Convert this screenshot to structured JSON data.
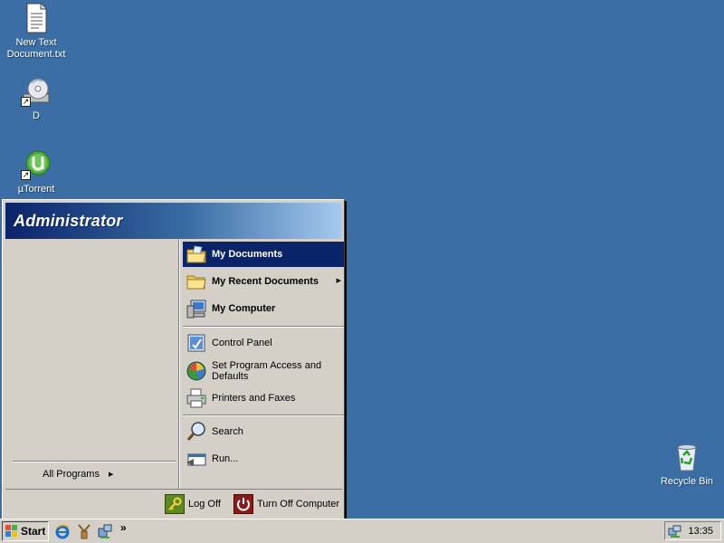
{
  "desktop": {
    "icons": [
      {
        "label": "New Text Document.txt"
      },
      {
        "label": "D"
      },
      {
        "label": "µTorrent"
      },
      {
        "label": "Recycle Bin"
      }
    ]
  },
  "start_menu": {
    "user": "Administrator",
    "all_programs": "All Programs",
    "items": [
      {
        "label": "My Documents"
      },
      {
        "label": "My Recent Documents"
      },
      {
        "label": "My Computer"
      },
      {
        "label": "Control Panel"
      },
      {
        "label": "Set Program Access and Defaults"
      },
      {
        "label": "Printers and Faxes"
      },
      {
        "label": "Search"
      },
      {
        "label": "Run..."
      }
    ],
    "log_off": "Log Off",
    "turn_off": "Turn Off Computer"
  },
  "taskbar": {
    "start_label": "Start",
    "overflow": "»",
    "clock": "13:35"
  },
  "colors": {
    "desktop": "#3a6ea5",
    "selection": "#0a246a",
    "face": "#d4d0c8"
  }
}
